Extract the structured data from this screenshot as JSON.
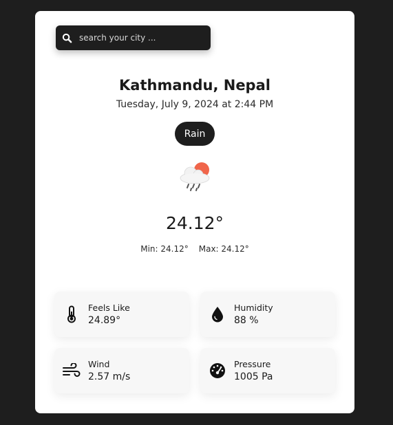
{
  "search": {
    "placeholder": "search your city ...",
    "value": ""
  },
  "location": {
    "city": "Kathmandu, Nepal",
    "datetime": "Tuesday, July 9, 2024 at 2:44 PM"
  },
  "condition": {
    "label": "Rain",
    "icon": "cloud-rain-sun-icon"
  },
  "temperature": {
    "current": "24.12°",
    "min": "Min: 24.12°",
    "max": "Max: 24.12°"
  },
  "stats": {
    "feels_like": {
      "label": "Feels Like",
      "value": "24.89°",
      "icon": "thermometer-icon"
    },
    "humidity": {
      "label": "Humidity",
      "value": "88 %",
      "icon": "water-drop-icon"
    },
    "wind": {
      "label": "Wind",
      "value": "2.57 m/s",
      "icon": "wind-icon"
    },
    "pressure": {
      "label": "Pressure",
      "value": "1005 Pa",
      "icon": "gauge-icon"
    }
  },
  "colors": {
    "background": "#1e1e1e",
    "card": "#ffffff",
    "stat_card": "#f7f7f7",
    "sun": "#f0654a"
  }
}
